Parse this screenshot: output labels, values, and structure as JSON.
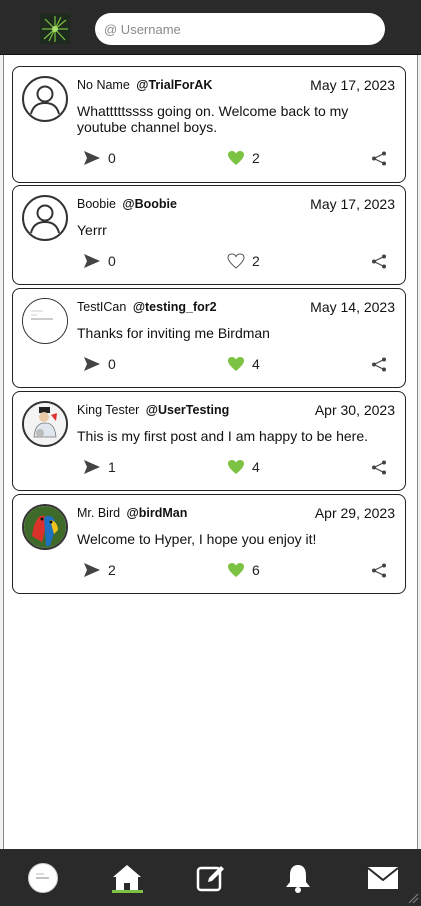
{
  "header": {
    "search_placeholder": "@ Username"
  },
  "colors": {
    "accent": "#7cc243",
    "bar": "#2a2a2a",
    "border": "#222222"
  },
  "posts": [
    {
      "name": "No Name",
      "handle": "@TrialForAK",
      "date": "May 17, 2023",
      "text": "Whatttttssss going on. Welcome back to my youtube channel boys.",
      "shares": "0",
      "likes": "2",
      "liked": true,
      "avatar": "default-user-icon"
    },
    {
      "name": "Boobie",
      "handle": "@Boobie",
      "date": "May 17, 2023",
      "text": "Yerrr",
      "shares": "0",
      "likes": "2",
      "liked": false,
      "avatar": "default-user-icon"
    },
    {
      "name": "TestICan",
      "handle": "@testing_for2",
      "date": "May 14, 2023",
      "text": "Thanks for inviting me Birdman",
      "shares": "0",
      "likes": "4",
      "liked": true,
      "avatar": "screenshot-thumbnail"
    },
    {
      "name": "King Tester",
      "handle": "@UserTesting",
      "date": "Apr 30, 2023",
      "text": "This is my first post and I am happy to be here.",
      "shares": "1",
      "likes": "4",
      "liked": true,
      "avatar": "cartoon-figure"
    },
    {
      "name": "Mr. Bird",
      "handle": "@birdMan",
      "date": "Apr 29, 2023",
      "text": "Welcome to Hyper, I hope you enjoy it!",
      "shares": "2",
      "likes": "6",
      "liked": true,
      "avatar": "parrot-photo"
    }
  ],
  "bottom_nav": [
    {
      "name": "profile",
      "icon": "profile-avatar-icon"
    },
    {
      "name": "home",
      "icon": "home-icon",
      "active": true
    },
    {
      "name": "compose",
      "icon": "compose-icon"
    },
    {
      "name": "notifications",
      "icon": "bell-icon"
    },
    {
      "name": "messages",
      "icon": "mail-icon"
    }
  ]
}
